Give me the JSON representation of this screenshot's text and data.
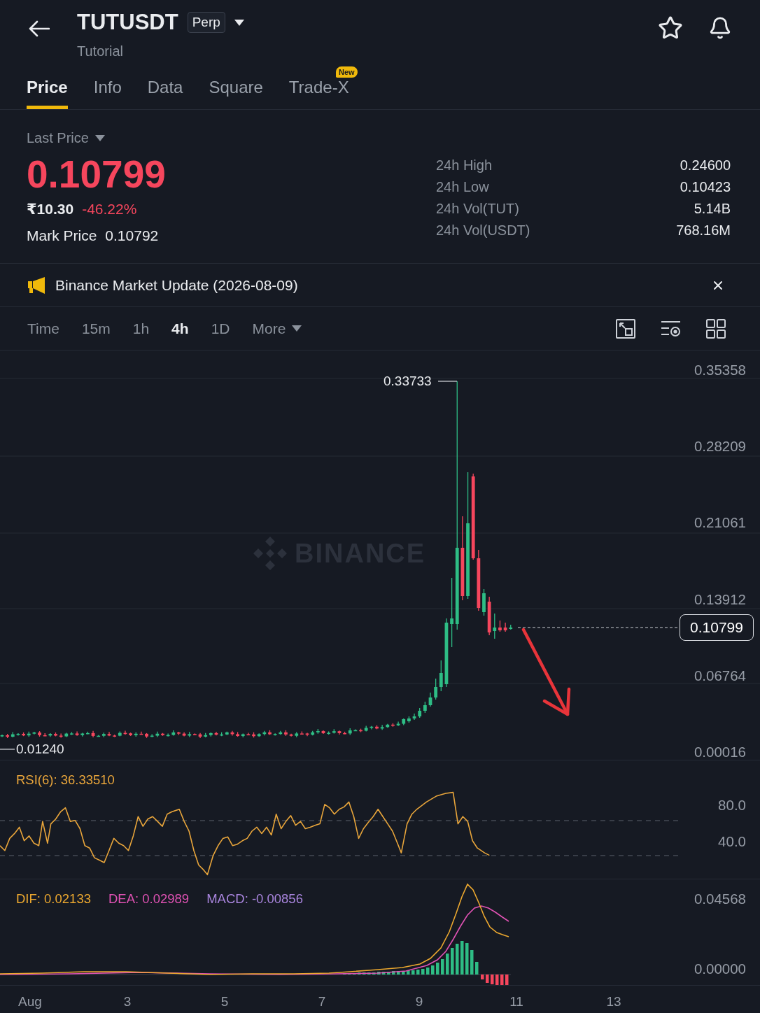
{
  "header": {
    "symbol": "TUTUSDT",
    "contract_type": "Perp",
    "subtitle": "Tutorial"
  },
  "tabs": [
    {
      "label": "Price",
      "selected": true
    },
    {
      "label": "Info",
      "selected": false
    },
    {
      "label": "Data",
      "selected": false
    },
    {
      "label": "Square",
      "selected": false
    },
    {
      "label": "Trade-X",
      "selected": false,
      "badge": "New"
    }
  ],
  "price": {
    "label": "Last Price",
    "last": "0.10799",
    "falling": true,
    "fiat": "₹10.30",
    "change": "-46.22%",
    "mark_label": "Mark Price",
    "mark": "0.10792"
  },
  "stats": [
    {
      "label": "24h High",
      "value": "0.24600"
    },
    {
      "label": "24h Low",
      "value": "0.10423"
    },
    {
      "label": "24h Vol(TUT)",
      "value": "5.14B"
    },
    {
      "label": "24h Vol(USDT)",
      "value": "768.16M"
    }
  ],
  "announcement": {
    "text": "Binance Market Update (2026-08-09)"
  },
  "intervals": [
    {
      "label": "Time",
      "kind": "option",
      "selected": false
    },
    {
      "label": "15m",
      "kind": "option",
      "selected": false
    },
    {
      "label": "1h",
      "kind": "option",
      "selected": false
    },
    {
      "label": "4h",
      "kind": "option",
      "selected": true
    },
    {
      "label": "1D",
      "kind": "option",
      "selected": false
    },
    {
      "label": "More",
      "kind": "menu",
      "selected": false
    }
  ],
  "chart": {
    "watermark": "BINANCE",
    "y_axis_labels": [
      "0.35358",
      "0.28209",
      "0.21061",
      "0.13912",
      "0.06764",
      "0.00016"
    ],
    "high_label": "0.33733",
    "low_label": "0.01240",
    "last_price_tag": "0.10799"
  },
  "rsi": {
    "legend": "RSI(6): 36.33510",
    "y_axis_labels": [
      "80.0",
      "40.0"
    ]
  },
  "macd": {
    "legend": [
      {
        "text": "DIF: 0.02133",
        "color": "#eca82f"
      },
      {
        "text": "DEA: 0.02989",
        "color": "#e052b4"
      },
      {
        "text": "MACD: -0.00856",
        "color": "#a985de"
      }
    ],
    "y_axis_labels": [
      "0.04568",
      "0.00000"
    ]
  },
  "x_axis_labels": [
    "Aug",
    "3",
    "5",
    "7",
    "9",
    "11",
    "13"
  ]
}
